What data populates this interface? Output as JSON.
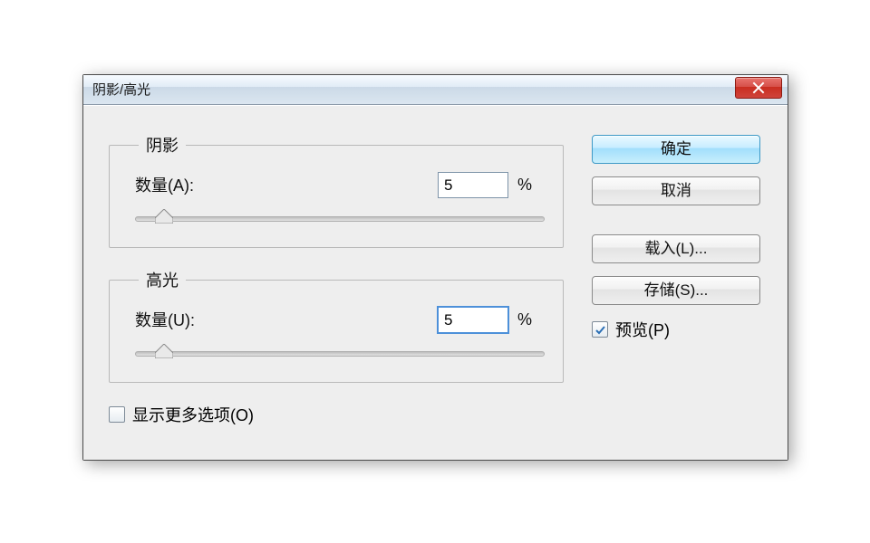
{
  "dialog": {
    "title": "阴影/高光",
    "shadows": {
      "legend": "阴影",
      "amount_label": "数量(A):",
      "amount_value": "5",
      "unit": "%",
      "slider_pct": 5
    },
    "highlights": {
      "legend": "高光",
      "amount_label": "数量(U):",
      "amount_value": "5",
      "unit": "%",
      "slider_pct": 5
    },
    "show_more": {
      "label": "显示更多选项(O)",
      "checked": false
    },
    "buttons": {
      "ok": "确定",
      "cancel": "取消",
      "load": "载入(L)...",
      "save": "存储(S)..."
    },
    "preview": {
      "label": "预览(P)",
      "checked": true
    }
  }
}
